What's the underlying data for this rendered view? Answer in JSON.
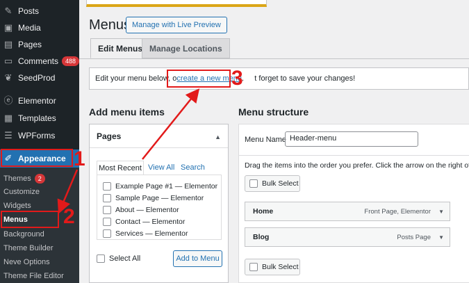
{
  "sidebar": {
    "items": [
      {
        "label": "Posts",
        "icon": "pin-icon"
      },
      {
        "label": "Media",
        "icon": "media-icon"
      },
      {
        "label": "Pages",
        "icon": "pages-icon"
      },
      {
        "label": "Comments",
        "icon": "comment-icon",
        "badge": "488"
      },
      {
        "label": "SeedProd",
        "icon": "seedprod-icon"
      },
      {
        "label": "Elementor",
        "icon": "elementor-icon"
      },
      {
        "label": "Templates",
        "icon": "templates-icon"
      },
      {
        "label": "WPForms",
        "icon": "wpforms-icon"
      },
      {
        "label": "Appearance",
        "icon": "paintbrush-icon"
      }
    ],
    "submenu": [
      {
        "label": "Themes",
        "badge": "2"
      },
      {
        "label": "Customize"
      },
      {
        "label": "Widgets"
      },
      {
        "label": "Menus"
      },
      {
        "label": "Background"
      },
      {
        "label": "Theme Builder"
      },
      {
        "label": "Neve Options"
      },
      {
        "label": "Theme File Editor"
      }
    ]
  },
  "annotations": {
    "step1": "1",
    "step2": "2",
    "step3": "3",
    "color": "#e21a1a"
  },
  "header": {
    "title": "Menus",
    "live_preview_label": "Manage with Live Preview"
  },
  "tabs": [
    "Edit Menus",
    "Manage Locations"
  ],
  "info": {
    "before": "Edit your menu below, o",
    "link": "create a new menu",
    "after": ".     t forget to save your changes!"
  },
  "add_items": {
    "title": "Add menu items",
    "panel_title": "Pages",
    "subtabs": [
      "Most Recent",
      "View All",
      "Search"
    ],
    "pages": [
      "Example Page #1 — Elementor",
      "Sample Page — Elementor",
      "About — Elementor",
      "Contact — Elementor",
      "Services — Elementor"
    ],
    "select_all_label": "Select All",
    "add_button_label": "Add to Menu"
  },
  "structure": {
    "title": "Menu structure",
    "menu_name_label": "Menu Name",
    "menu_name_value": "Header-menu",
    "drag_text": "Drag the items into the order you prefer. Click the arrow on the right of the",
    "bulk_select_label": "Bulk Select",
    "items": [
      {
        "title": "Home",
        "type": "Front Page, Elementor"
      },
      {
        "title": "Blog",
        "type": "Posts Page"
      }
    ]
  }
}
